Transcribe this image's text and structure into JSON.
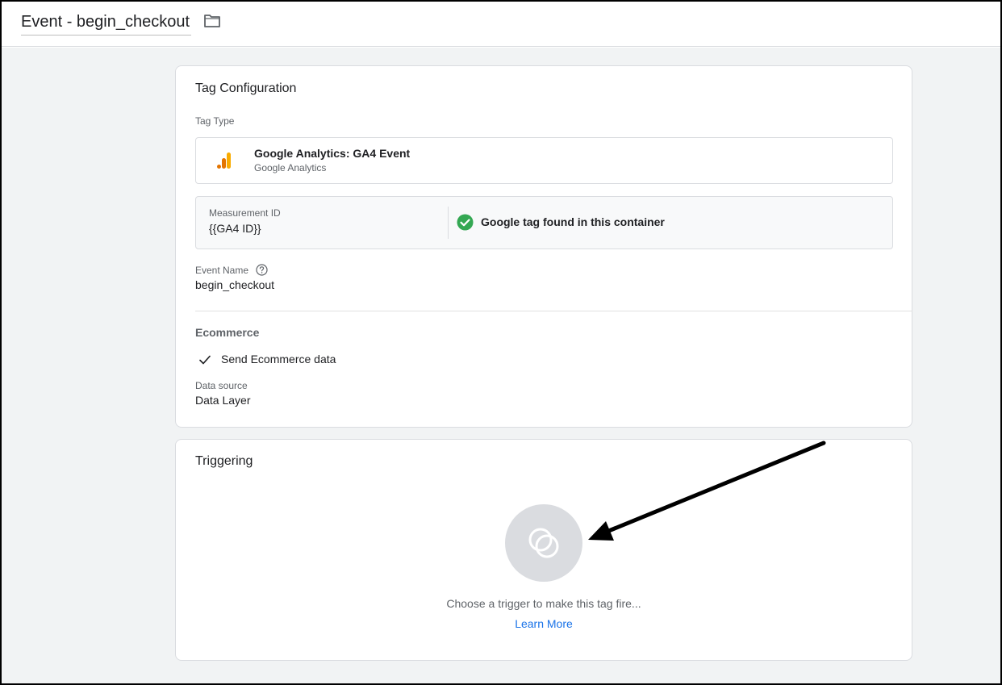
{
  "header": {
    "tag_name": "Event - begin_checkout",
    "folder_icon": "folder-icon"
  },
  "tag_configuration": {
    "title": "Tag Configuration",
    "tag_type_label": "Tag Type",
    "tag_type": {
      "name": "Google Analytics: GA4 Event",
      "subtitle": "Google Analytics",
      "icon": "google-analytics-icon"
    },
    "measurement": {
      "label": "Measurement ID",
      "value": "{{GA4 ID}}",
      "status_text": "Google tag found in this container",
      "status_icon": "check-circle-icon",
      "status_color": "#34a853"
    },
    "event_name": {
      "label": "Event Name",
      "help_icon": "help-icon",
      "value": "begin_checkout"
    },
    "ecommerce": {
      "section_label": "Ecommerce",
      "send_label": "Send Ecommerce data",
      "send_checked": true,
      "data_source_label": "Data source",
      "data_source_value": "Data Layer"
    }
  },
  "triggering": {
    "title": "Triggering",
    "empty_icon": "trigger-icon",
    "empty_text": "Choose a trigger to make this tag fire...",
    "learn_more": "Learn More"
  },
  "colors": {
    "accent": "#1a73e8",
    "ga_orange": "#f9ab00",
    "ga_dark_orange": "#e37400",
    "success": "#34a853"
  }
}
